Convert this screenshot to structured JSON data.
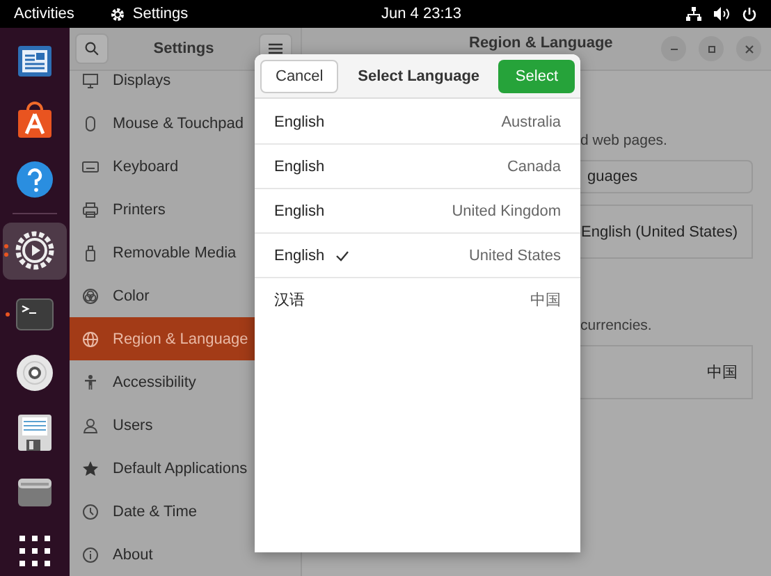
{
  "top_bar": {
    "activities": "Activities",
    "app": "Settings",
    "clock": "Jun 4  23:13"
  },
  "dock": [
    {
      "kind": "editor",
      "running": false,
      "active": false
    },
    {
      "kind": "store",
      "running": false,
      "active": false
    },
    {
      "kind": "help",
      "running": false,
      "active": false
    },
    {
      "kind": "settings",
      "running": true,
      "active": true
    },
    {
      "kind": "terminal",
      "running": true,
      "active": false
    },
    {
      "kind": "disc",
      "running": false,
      "active": false
    },
    {
      "kind": "save",
      "running": false,
      "active": false
    },
    {
      "kind": "drive",
      "running": false,
      "active": false
    },
    {
      "kind": "apps",
      "running": false,
      "active": false
    }
  ],
  "sidebar": {
    "title": "Settings",
    "items": [
      {
        "label": "Displays",
        "selected": false
      },
      {
        "label": "Mouse & Touchpad",
        "selected": false
      },
      {
        "label": "Keyboard",
        "selected": false
      },
      {
        "label": "Printers",
        "selected": false
      },
      {
        "label": "Removable Media",
        "selected": false
      },
      {
        "label": "Color",
        "selected": false
      },
      {
        "label": "Region & Language",
        "selected": true
      },
      {
        "label": "Accessibility",
        "selected": false
      },
      {
        "label": "Users",
        "selected": false
      },
      {
        "label": "Default Applications",
        "selected": false
      },
      {
        "label": "Date & Time",
        "selected": false
      },
      {
        "label": "About",
        "selected": false
      }
    ]
  },
  "page": {
    "title": "Region & Language",
    "text_1": "d web pages.",
    "button": "guages",
    "language_value": "English (United States)",
    "text_2": "currencies.",
    "formats_value": "中国"
  },
  "dialog": {
    "title": "Select Language",
    "cancel": "Cancel",
    "confirm": "Select",
    "languages": [
      {
        "language": "English",
        "region": "Australia",
        "selected": false
      },
      {
        "language": "English",
        "region": "Canada",
        "selected": false
      },
      {
        "language": "English",
        "region": "United Kingdom",
        "selected": false
      },
      {
        "language": "English",
        "region": "United States",
        "selected": true
      },
      {
        "language": "汉语",
        "region": "中国",
        "selected": false
      }
    ]
  }
}
